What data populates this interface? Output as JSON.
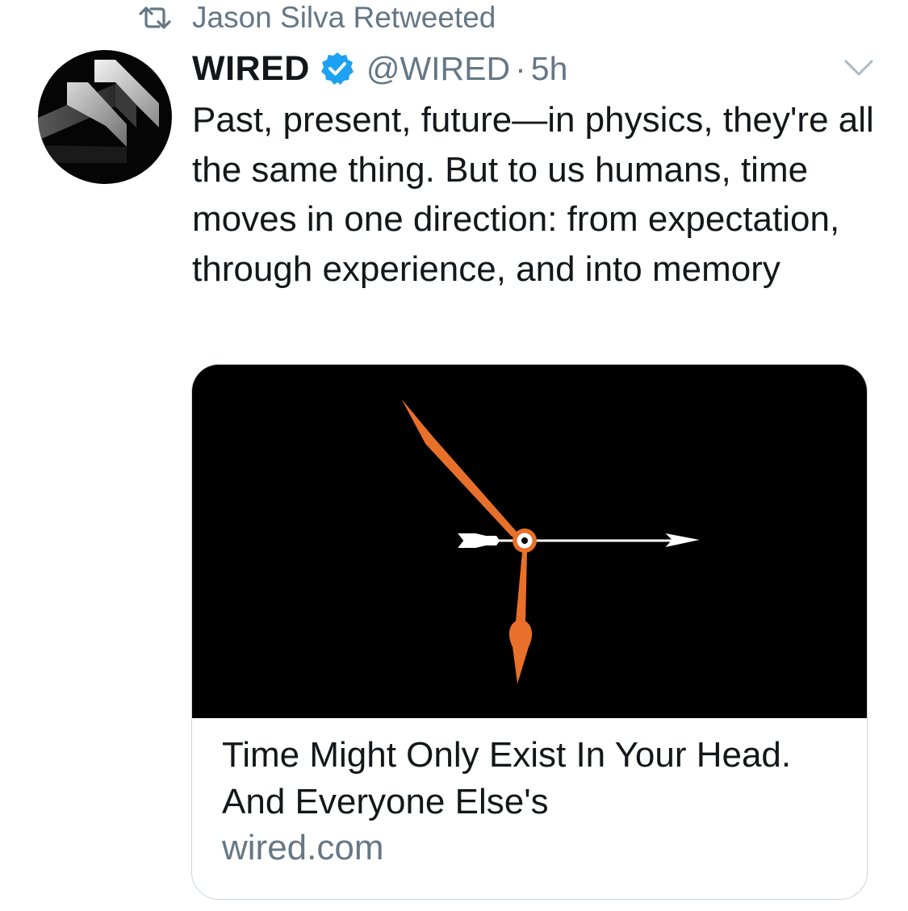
{
  "retweet": {
    "icon": "retweet-icon",
    "text": "Jason Silva Retweeted"
  },
  "tweet": {
    "author_name": "WIRED",
    "verified_icon": "verified-badge-icon",
    "handle": "@WIRED",
    "separator": "·",
    "time": "5h",
    "text": "Past, present, future—in physics, they're all the same thing. But to us humans, time moves in one direction: from expectation, through experience, and into memory",
    "menu_icon": "chevron-down-icon"
  },
  "card": {
    "image_icon": "clock-hands-arrow-image",
    "title": "Time Might Only Exist In Your Head. And Everyone Else's",
    "domain": "wired.com"
  },
  "colors": {
    "text": "#14171a",
    "secondary": "#657786",
    "verified_blue": "#1da1f2",
    "clock_orange": "#e8702a",
    "card_border": "#ccd6dd"
  }
}
